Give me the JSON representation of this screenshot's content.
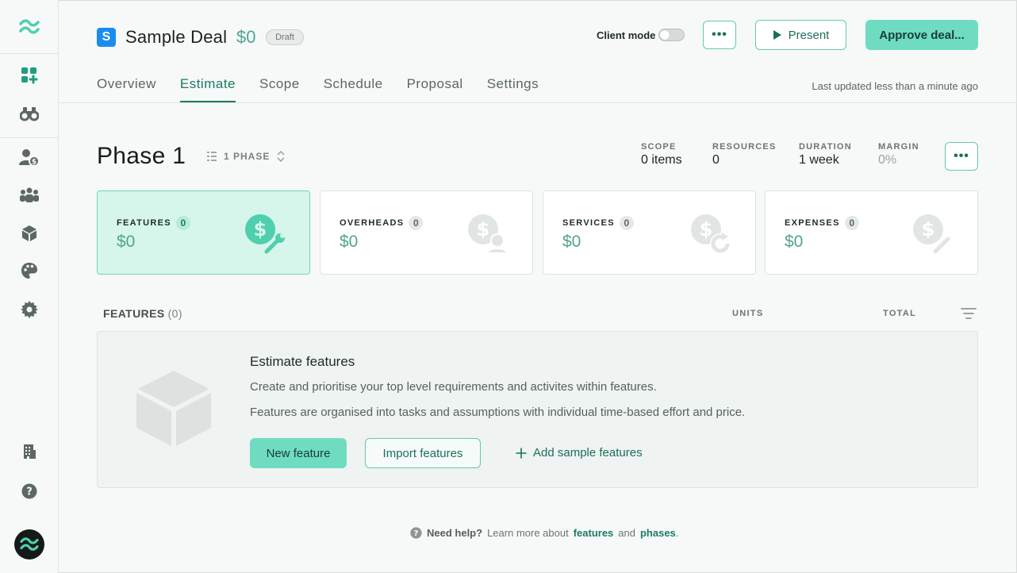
{
  "deal": {
    "badge_letter": "S",
    "title": "Sample Deal",
    "value": "$0",
    "status": "Draft"
  },
  "header": {
    "client_mode_label": "Client mode",
    "client_mode_on": false,
    "more_label": "•••",
    "present_label": "Present",
    "approve_label": "Approve deal..."
  },
  "tabs": [
    {
      "label": "Overview",
      "active": false
    },
    {
      "label": "Estimate",
      "active": true
    },
    {
      "label": "Scope",
      "active": false
    },
    {
      "label": "Schedule",
      "active": false
    },
    {
      "label": "Proposal",
      "active": false
    },
    {
      "label": "Settings",
      "active": false
    }
  ],
  "last_updated": "Last updated less than a minute ago",
  "phase": {
    "title": "Phase 1",
    "picker_label": "1 PHASE",
    "more_label": "•••",
    "stats": [
      {
        "label": "SCOPE",
        "value": "0 items"
      },
      {
        "label": "RESOURCES",
        "value": "0"
      },
      {
        "label": "DURATION",
        "value": "1 week"
      },
      {
        "label": "MARGIN",
        "value": "0%"
      }
    ]
  },
  "cards": [
    {
      "label": "FEATURES",
      "count": "0",
      "value": "$0",
      "icon": "dollar-wrench-icon"
    },
    {
      "label": "OVERHEADS",
      "count": "0",
      "value": "$0",
      "icon": "dollar-person-icon"
    },
    {
      "label": "SERVICES",
      "count": "0",
      "value": "$0",
      "icon": "dollar-refresh-icon"
    },
    {
      "label": "EXPENSES",
      "count": "0",
      "value": "$0",
      "icon": "dollar-pen-icon"
    }
  ],
  "features_table": {
    "title": "FEATURES",
    "count": "(0)",
    "col_units": "UNITS",
    "col_total": "TOTAL"
  },
  "empty_state": {
    "title": "Estimate features",
    "line1": "Create and prioritise your top level requirements and activites within features.",
    "line2": "Features are organised into tasks and assumptions with individual time-based effort and price.",
    "new_button": "New feature",
    "import_button": "Import features",
    "sample_button": "Add sample features"
  },
  "help": {
    "lead": "Need help?",
    "text": "Learn more about",
    "link1": "features",
    "and": "and",
    "link2": "phases",
    "end": "."
  },
  "colors": {
    "accent": "#6fdcc2",
    "accent_dark": "#1d7a65",
    "money": "#4fa58f",
    "badge_blue": "#1a8cf0"
  }
}
